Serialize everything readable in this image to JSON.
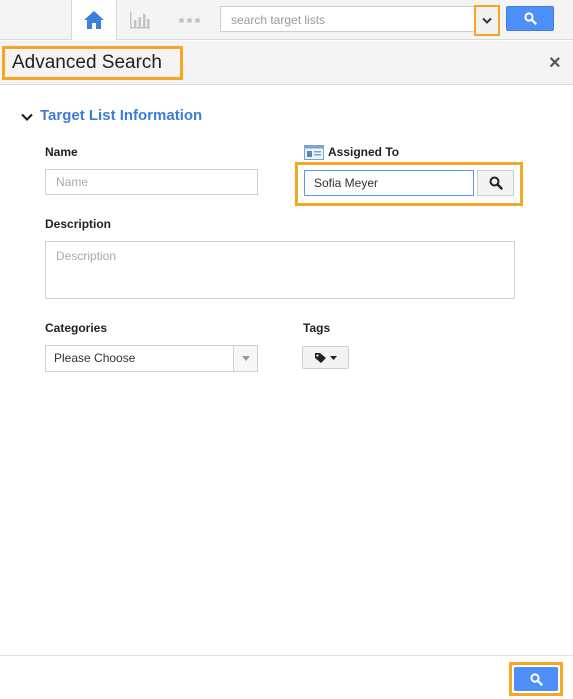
{
  "topbar": {
    "search_placeholder": "search target lists"
  },
  "panel": {
    "title": "Advanced Search",
    "close_symbol": "×"
  },
  "section": {
    "title": "Target List Information"
  },
  "form": {
    "name_label": "Name",
    "name_placeholder": "Name",
    "assigned_label": "Assigned To",
    "assigned_value": "Sofia Meyer",
    "description_label": "Description",
    "description_placeholder": "Description",
    "categories_label": "Categories",
    "categories_selected": "Please Choose",
    "tags_label": "Tags"
  },
  "colors": {
    "accent": "#4d8ef7",
    "highlight": "#f5a623",
    "section_title": "#3b7ddd"
  }
}
